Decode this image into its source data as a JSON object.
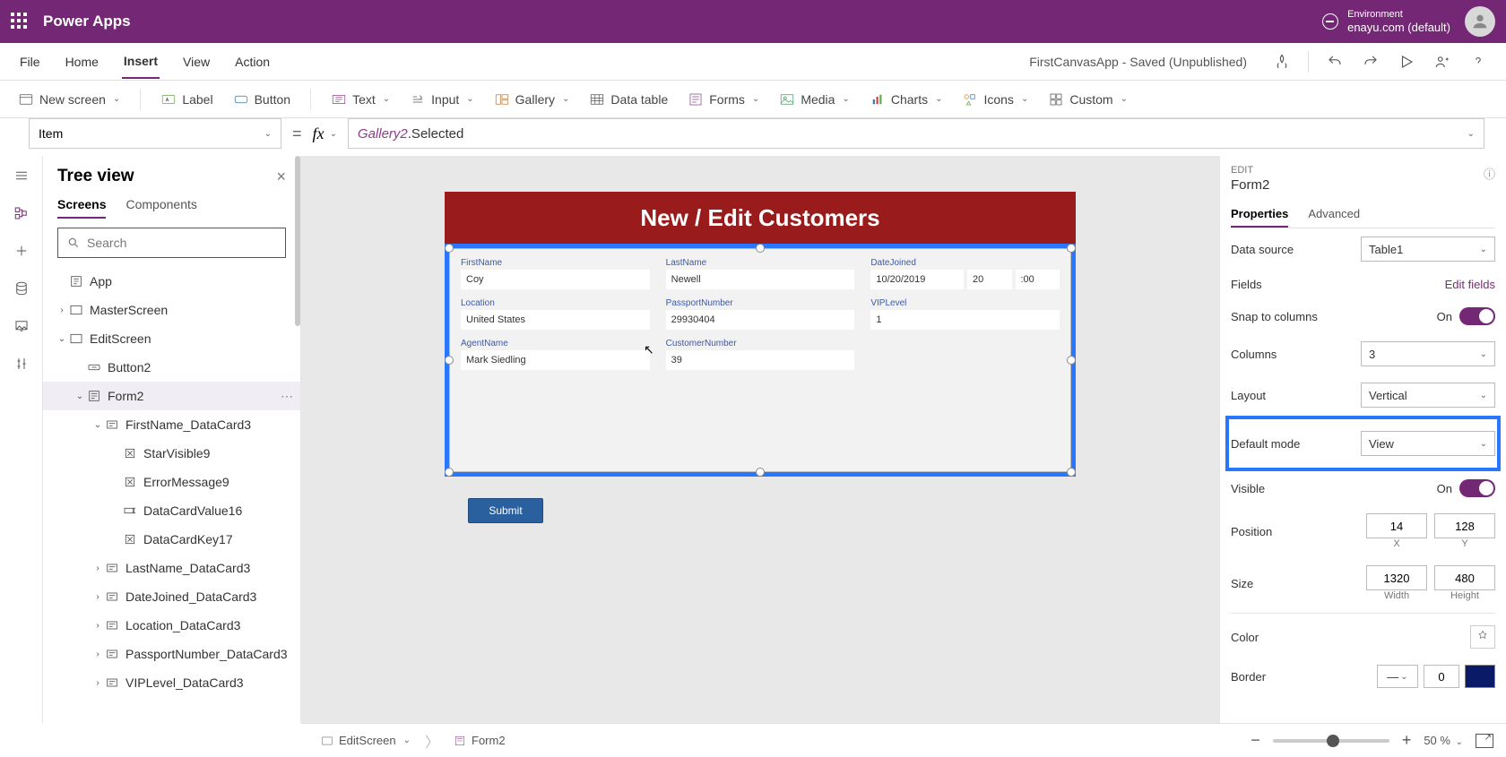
{
  "header": {
    "brand": "Power Apps",
    "env_label": "Environment",
    "env_name": "enayu.com (default)"
  },
  "menubar": {
    "items": [
      "File",
      "Home",
      "Insert",
      "View",
      "Action"
    ],
    "active": "Insert",
    "app_status": "FirstCanvasApp - Saved (Unpublished)"
  },
  "ribbon": {
    "new_screen": "New screen",
    "label": "Label",
    "button": "Button",
    "text": "Text",
    "input": "Input",
    "gallery": "Gallery",
    "data_table": "Data table",
    "forms": "Forms",
    "media": "Media",
    "charts": "Charts",
    "icons": "Icons",
    "custom": "Custom"
  },
  "formula": {
    "property": "Item",
    "token1": "Gallery2",
    "token2": ".Selected"
  },
  "tree": {
    "title": "Tree view",
    "tabs": [
      "Screens",
      "Components"
    ],
    "search_ph": "Search",
    "items": [
      {
        "indent": 0,
        "caret": "",
        "label": "App",
        "type": "app"
      },
      {
        "indent": 0,
        "caret": ">",
        "label": "MasterScreen",
        "type": "screen"
      },
      {
        "indent": 0,
        "caret": "v",
        "label": "EditScreen",
        "type": "screen"
      },
      {
        "indent": 1,
        "caret": "",
        "label": "Button2",
        "type": "btn"
      },
      {
        "indent": 1,
        "caret": "v",
        "label": "Form2",
        "type": "form",
        "sel": true,
        "dots": true
      },
      {
        "indent": 2,
        "caret": "v",
        "label": "FirstName_DataCard3",
        "type": "card"
      },
      {
        "indent": 3,
        "caret": "",
        "label": "StarVisible9",
        "type": "ctrl"
      },
      {
        "indent": 3,
        "caret": "",
        "label": "ErrorMessage9",
        "type": "ctrl"
      },
      {
        "indent": 3,
        "caret": "",
        "label": "DataCardValue16",
        "type": "input"
      },
      {
        "indent": 3,
        "caret": "",
        "label": "DataCardKey17",
        "type": "ctrl"
      },
      {
        "indent": 2,
        "caret": ">",
        "label": "LastName_DataCard3",
        "type": "card"
      },
      {
        "indent": 2,
        "caret": ">",
        "label": "DateJoined_DataCard3",
        "type": "card"
      },
      {
        "indent": 2,
        "caret": ">",
        "label": "Location_DataCard3",
        "type": "card"
      },
      {
        "indent": 2,
        "caret": ">",
        "label": "PassportNumber_DataCard3",
        "type": "card"
      },
      {
        "indent": 2,
        "caret": ">",
        "label": "VIPLevel_DataCard3",
        "type": "card"
      }
    ]
  },
  "canvas": {
    "title": "New / Edit Customers",
    "fields": {
      "FirstName": {
        "label": "FirstName",
        "value": "Coy"
      },
      "LastName": {
        "label": "LastName",
        "value": "Newell"
      },
      "DateJoined": {
        "label": "DateJoined",
        "d": "10/20/2019",
        "h": "20",
        "m": ":00"
      },
      "Location": {
        "label": "Location",
        "value": "United States"
      },
      "PassportNumber": {
        "label": "PassportNumber",
        "value": "29930404"
      },
      "VIPLevel": {
        "label": "VIPLevel",
        "value": "1"
      },
      "AgentName": {
        "label": "AgentName",
        "value": "Mark Siedling"
      },
      "CustomerNumber": {
        "label": "CustomerNumber",
        "value": "39"
      }
    },
    "submit": "Submit"
  },
  "props": {
    "edit_label": "EDIT",
    "name": "Form2",
    "tabs": [
      "Properties",
      "Advanced"
    ],
    "data_source": {
      "label": "Data source",
      "value": "Table1"
    },
    "fields": {
      "label": "Fields",
      "link": "Edit fields"
    },
    "snap": {
      "label": "Snap to columns",
      "state": "On"
    },
    "columns": {
      "label": "Columns",
      "value": "3"
    },
    "layout": {
      "label": "Layout",
      "value": "Vertical"
    },
    "default_mode": {
      "label": "Default mode",
      "value": "View"
    },
    "visible": {
      "label": "Visible",
      "state": "On"
    },
    "position": {
      "label": "Position",
      "x": "14",
      "y": "128",
      "xl": "X",
      "yl": "Y"
    },
    "size": {
      "label": "Size",
      "w": "1320",
      "h": "480",
      "wl": "Width",
      "hl": "Height"
    },
    "color": {
      "label": "Color"
    },
    "border": {
      "label": "Border",
      "width": "0"
    }
  },
  "status": {
    "bc1": "EditScreen",
    "bc2": "Form2",
    "zoom": "50",
    "pct": "%"
  }
}
